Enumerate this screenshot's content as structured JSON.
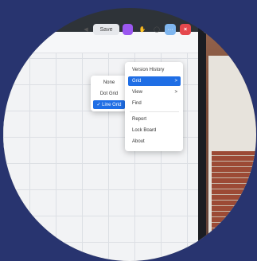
{
  "toolbar": {
    "save_label": "Save",
    "icons": [
      "speaker-icon",
      "app-icon",
      "hand-icon",
      "chat-icon",
      "more-icon",
      "close-icon"
    ],
    "close_glyph": "×",
    "more_glyph": "···"
  },
  "menu": {
    "items": [
      {
        "label": "Version History"
      },
      {
        "label": "Grid",
        "active": true
      },
      {
        "label": "View"
      },
      {
        "label": "Find"
      },
      {
        "label": "Report"
      },
      {
        "label": "Lock Board"
      },
      {
        "label": "About"
      }
    ],
    "chevron": ">"
  },
  "grid_submenu": {
    "options": [
      {
        "label": "None"
      },
      {
        "label": "Dot Grid"
      },
      {
        "label": "✓ Line Grid",
        "selected": true
      }
    ]
  },
  "colors": {
    "background": "#28346f",
    "accent": "#1f6ee5",
    "purple_icon": "#9b57f0",
    "close_red": "#e5484d"
  }
}
